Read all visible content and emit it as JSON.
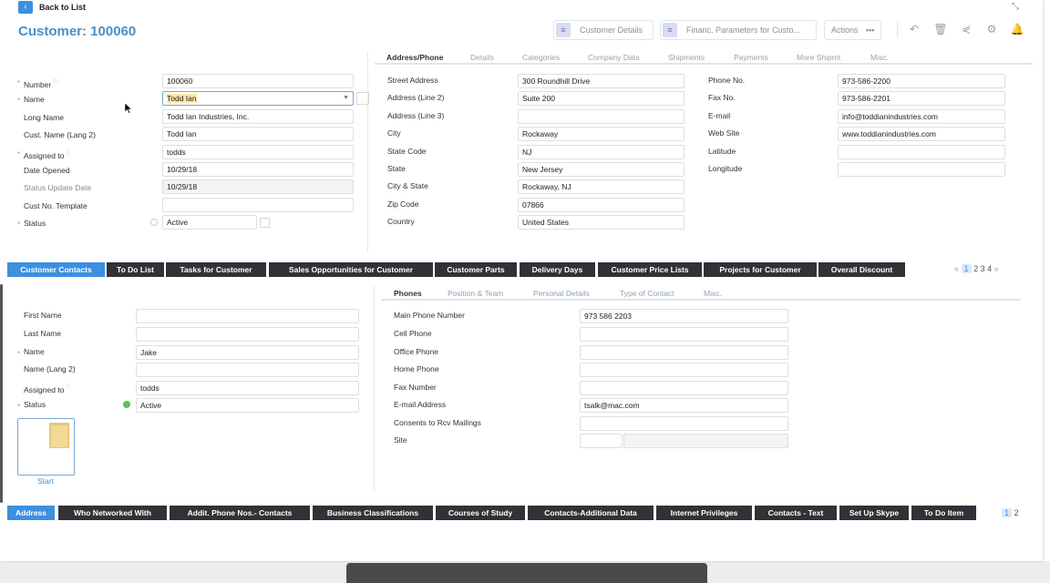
{
  "topbar": {
    "back_label": "Back to List"
  },
  "title": "Customer: 100060",
  "header_buttons": {
    "customer_details": "Customer Details",
    "financ": "Financ. Parameters for Custo...",
    "actions": "Actions"
  },
  "left_fields": [
    {
      "label": "Number",
      "value": "100060",
      "required": true,
      "info": true
    },
    {
      "label": "Name",
      "value": "Todd Ian",
      "required": true,
      "info": false
    },
    {
      "label": "Long Name",
      "value": "Todd Ian Industries, Inc.",
      "required": false,
      "info": false
    },
    {
      "label": "Cust. Name (Lang 2)",
      "value": "Todd Ian",
      "required": false,
      "info": false
    },
    {
      "label": "Assigned to",
      "value": "todds",
      "required": true,
      "info": true
    },
    {
      "label": "Date Opened",
      "value": "10/29/18",
      "required": false,
      "info": false
    },
    {
      "label": "Status Update Date",
      "value": "10/29/18",
      "required": false,
      "info": false
    },
    {
      "label": "Cust No. Template",
      "value": "",
      "required": false,
      "info": false
    },
    {
      "label": "Status",
      "value": "Active",
      "required": true,
      "info": false
    }
  ],
  "top_tabs": [
    "Address/Phone",
    "Details",
    "Categories",
    "Company Data",
    "Shipments",
    "Payments",
    "More Shipmt",
    "Misc."
  ],
  "address": [
    {
      "label": "Street Address",
      "value": "300 Roundhill Drive"
    },
    {
      "label": "Address (Line 2)",
      "value": "Suite 200"
    },
    {
      "label": "Address (Line 3)",
      "value": ""
    },
    {
      "label": "City",
      "value": "Rockaway"
    },
    {
      "label": "State Code",
      "value": "NJ"
    },
    {
      "label": "State",
      "value": "New Jersey"
    },
    {
      "label": "City & State",
      "value": "Rockaway, NJ"
    },
    {
      "label": "Zip Code",
      "value": "07866"
    },
    {
      "label": "Country",
      "value": "United States"
    }
  ],
  "phone": [
    {
      "label": "Phone No.",
      "value": "973-586-2200"
    },
    {
      "label": "Fax No.",
      "value": "973-586-2201"
    },
    {
      "label": "E-mail",
      "value": "info@toddianindustries.com"
    },
    {
      "label": "Web Site",
      "value": "www.toddianindustries.com"
    },
    {
      "label": "Latitude",
      "value": ""
    },
    {
      "label": "Longitude",
      "value": ""
    }
  ],
  "mid_tabs": [
    "Customer Contacts",
    "To Do List",
    "Tasks for Customer",
    "Sales Opportunities for Customer",
    "Customer Parts",
    "Delivery Days",
    "Customer Price Lists",
    "Projects for Customer",
    "Overall Discount"
  ],
  "mid_pager": {
    "prev": "«",
    "pages": [
      "1",
      "2",
      "3",
      "4"
    ],
    "next": "»"
  },
  "contact_fields": [
    {
      "label": "First Name",
      "value": "",
      "required": false,
      "info": false
    },
    {
      "label": "Last Name",
      "value": "",
      "required": false,
      "info": false
    },
    {
      "label": "Name",
      "value": "Jake",
      "required": true,
      "info": false
    },
    {
      "label": "Name (Lang 2)",
      "value": "",
      "required": false,
      "info": false
    },
    {
      "label": "Assigned to",
      "value": "todds",
      "required": false,
      "info": true
    },
    {
      "label": "Status",
      "value": "Active",
      "required": true,
      "info": false
    }
  ],
  "start_label": "Start",
  "contact_tabs": [
    "Phones",
    "Position & Team",
    "Personal Details",
    "Type of Contact",
    "Misc."
  ],
  "contact_phones": [
    {
      "label": "Main Phone Number",
      "value": "973 586 2203"
    },
    {
      "label": "Cell Phone",
      "value": ""
    },
    {
      "label": "Office Phone",
      "value": ""
    },
    {
      "label": "Home Phone",
      "value": ""
    },
    {
      "label": "Fax Number",
      "value": ""
    },
    {
      "label": "E-mail Address",
      "value": "tsalk@mac.com"
    },
    {
      "label": "Consents to Rcv Mailings",
      "value": ""
    },
    {
      "label": "Site",
      "value": ""
    }
  ],
  "bottom_tabs": [
    "Address",
    "Who Networked With",
    "Addit. Phone Nos.- Contacts",
    "Business Classifications",
    "Courses of Study",
    "Contacts-Additional Data",
    "Internet Privileges",
    "Contacts - Text",
    "Set Up Skype",
    "To Do Item"
  ],
  "bottom_pager": {
    "pages": [
      "1",
      "2"
    ]
  },
  "colors": {
    "accent": "#3d8fe0",
    "dark_tab": "#2f3338",
    "title": "#4a90c8",
    "status_active": "#5bc25b"
  }
}
